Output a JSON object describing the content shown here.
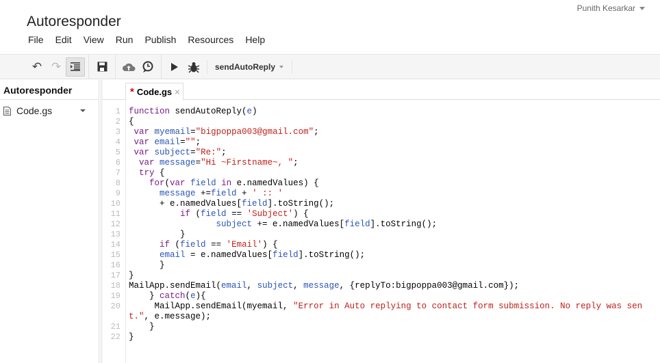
{
  "app": {
    "title": "Autoresponder",
    "user": "Punith Kesarkar"
  },
  "menu": [
    "File",
    "Edit",
    "View",
    "Run",
    "Publish",
    "Resources",
    "Help"
  ],
  "toolbar": {
    "function_select": "sendAutoReply",
    "icons": [
      "undo-icon",
      "redo-icon",
      "indent-icon",
      "save-icon",
      "deploy-icon",
      "triggers-icon",
      "run-icon",
      "debug-icon"
    ]
  },
  "sidebar": {
    "project": "Autoresponder",
    "files": [
      {
        "name": "Code.gs"
      }
    ]
  },
  "tabs": [
    {
      "label": "Code.gs",
      "modified_marker": "*",
      "close": "×"
    }
  ],
  "colors": {
    "keyword": "#7a1a8a",
    "variable": "#2a55b8",
    "string": "#c0201a"
  },
  "code": [
    [
      [
        "function",
        "k"
      ],
      [
        " sendAutoReply(",
        "p"
      ],
      [
        "e",
        "v"
      ],
      [
        ")",
        "p"
      ]
    ],
    [
      [
        "{",
        "p"
      ]
    ],
    [
      [
        " ",
        "p"
      ],
      [
        "var",
        "k"
      ],
      [
        " ",
        "p"
      ],
      [
        "myemail",
        "v"
      ],
      [
        "=",
        "p"
      ],
      [
        "\"bigpoppa003@gmail.com\"",
        "s"
      ],
      [
        ";",
        "p"
      ]
    ],
    [
      [
        " ",
        "p"
      ],
      [
        "var",
        "k"
      ],
      [
        " ",
        "p"
      ],
      [
        "email",
        "v"
      ],
      [
        "=",
        "p"
      ],
      [
        "\"\"",
        "s"
      ],
      [
        ";",
        "p"
      ]
    ],
    [
      [
        " ",
        "p"
      ],
      [
        "var",
        "k"
      ],
      [
        " ",
        "p"
      ],
      [
        "subject",
        "v"
      ],
      [
        "=",
        "p"
      ],
      [
        "\"Re:\"",
        "s"
      ],
      [
        ";",
        "p"
      ]
    ],
    [
      [
        "  ",
        "p"
      ],
      [
        "var",
        "k"
      ],
      [
        " ",
        "p"
      ],
      [
        "message",
        "v"
      ],
      [
        "=",
        "p"
      ],
      [
        "\"Hi ~Firstname~, \"",
        "s"
      ],
      [
        ";",
        "p"
      ]
    ],
    [
      [
        "  ",
        "p"
      ],
      [
        "try",
        "k"
      ],
      [
        " {",
        "p"
      ]
    ],
    [
      [
        "    ",
        "p"
      ],
      [
        "for",
        "k"
      ],
      [
        "(",
        "p"
      ],
      [
        "var",
        "k"
      ],
      [
        " ",
        "p"
      ],
      [
        "field",
        "v"
      ],
      [
        " ",
        "p"
      ],
      [
        "in",
        "k"
      ],
      [
        " e.namedValues) {",
        "p"
      ]
    ],
    [
      [
        "      ",
        "p"
      ],
      [
        "message",
        "v"
      ],
      [
        " +=",
        "p"
      ],
      [
        "field",
        "v"
      ],
      [
        " + ",
        "p"
      ],
      [
        "' :: '",
        "s"
      ]
    ],
    [
      [
        "      + e.namedValues[",
        "p"
      ],
      [
        "field",
        "v"
      ],
      [
        "].toString();",
        "p"
      ]
    ],
    [
      [
        "          ",
        "p"
      ],
      [
        "if",
        "k"
      ],
      [
        " (",
        "p"
      ],
      [
        "field",
        "v"
      ],
      [
        " == ",
        "p"
      ],
      [
        "'Subject'",
        "s"
      ],
      [
        ") {",
        "p"
      ]
    ],
    [
      [
        "                 ",
        "p"
      ],
      [
        "subject",
        "v"
      ],
      [
        " += e.namedValues[",
        "p"
      ],
      [
        "field",
        "v"
      ],
      [
        "].toString();",
        "p"
      ]
    ],
    [
      [
        "          }",
        "p"
      ]
    ],
    [
      [
        "      ",
        "p"
      ],
      [
        "if",
        "k"
      ],
      [
        " (",
        "p"
      ],
      [
        "field",
        "v"
      ],
      [
        " == ",
        "p"
      ],
      [
        "'Email'",
        "s"
      ],
      [
        ") {",
        "p"
      ]
    ],
    [
      [
        "      ",
        "p"
      ],
      [
        "email",
        "v"
      ],
      [
        " = e.namedValues[",
        "p"
      ],
      [
        "field",
        "v"
      ],
      [
        "].toString();",
        "p"
      ]
    ],
    [
      [
        "      }",
        "p"
      ]
    ],
    [
      [
        "}",
        "p"
      ]
    ],
    [
      [
        "MailApp.sendEmail(",
        "p"
      ],
      [
        "email",
        "v"
      ],
      [
        ", ",
        "p"
      ],
      [
        "subject",
        "v"
      ],
      [
        ", ",
        "p"
      ],
      [
        "message",
        "v"
      ],
      [
        ", {replyTo:bigpoppa003@gmail.com});",
        "p"
      ]
    ],
    [
      [
        "    } ",
        "p"
      ],
      [
        "catch",
        "k"
      ],
      [
        "(",
        "p"
      ],
      [
        "e",
        "v"
      ],
      [
        "){",
        "p"
      ]
    ],
    [
      [
        "     MailApp.sendEmail(myemail, ",
        "p"
      ],
      [
        "\"Error in Auto replying to contact form submission. No reply was sent.\"",
        "s"
      ],
      [
        ", e.message);",
        "p"
      ]
    ],
    [
      [
        "    }",
        "p"
      ]
    ],
    [
      [
        "}",
        "p"
      ]
    ]
  ]
}
